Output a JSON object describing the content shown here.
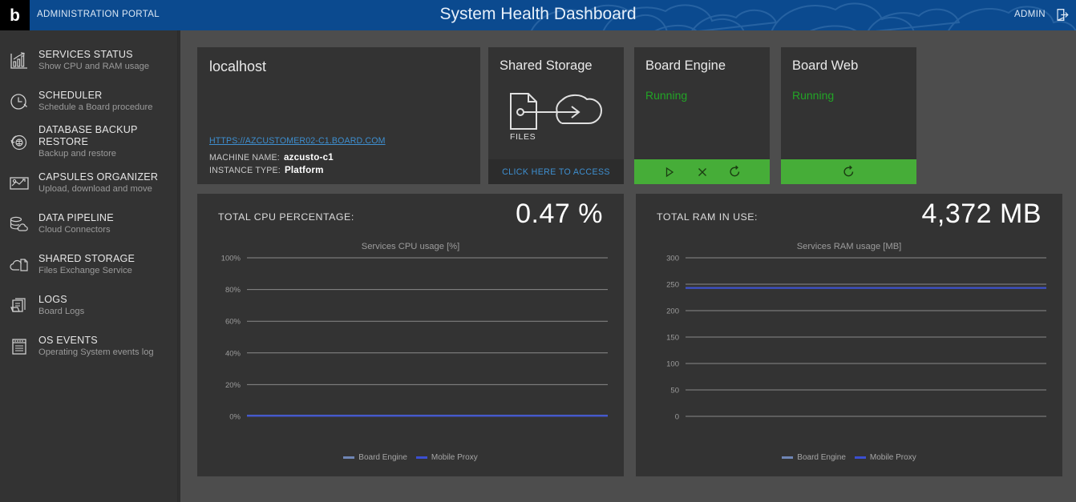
{
  "header": {
    "logo_glyph": "b",
    "portal_label": "ADMINISTRATION PORTAL",
    "title": "System Health Dashboard",
    "admin_label": "ADMIN",
    "logout_icon": "logout-icon",
    "bg_color": "#0b4a8f"
  },
  "sidebar": {
    "items": [
      {
        "icon": "chart-bars-icon",
        "title": "SERVICES STATUS",
        "subtitle": "Show CPU and RAM usage"
      },
      {
        "icon": "clock-icon",
        "title": "SCHEDULER",
        "subtitle": "Schedule a Board procedure"
      },
      {
        "icon": "database-sync-icon",
        "title": "DATABASE BACKUP RESTORE",
        "subtitle": "Backup and restore"
      },
      {
        "icon": "capsule-box-icon",
        "title": "CAPSULES ORGANIZER",
        "subtitle": "Upload, download and move"
      },
      {
        "icon": "data-pipeline-icon",
        "title": "DATA PIPELINE",
        "subtitle": "Cloud Connectors"
      },
      {
        "icon": "cloud-files-icon",
        "title": "SHARED STORAGE",
        "subtitle": "Files Exchange Service"
      },
      {
        "icon": "logs-icon",
        "title": "LOGS",
        "subtitle": "Board Logs"
      },
      {
        "icon": "events-list-icon",
        "title": "OS EVENTS",
        "subtitle": "Operating System events log"
      }
    ]
  },
  "main": {
    "host_card": {
      "title": "localhost",
      "link": "HTTPS://AZCUSTOMER02-C1.BOARD.COM",
      "machine_name_label": "MACHINE NAME:",
      "machine_name_value": "azcusto-c1",
      "instance_type_label": "INSTANCE TYPE:",
      "instance_type_value": "Platform"
    },
    "storage_card": {
      "title": "Shared Storage",
      "icon": "files-to-cloud-icon",
      "files_label": "FILES",
      "access_label": "CLICK HERE TO ACCESS",
      "link_color": "#3e8fd0"
    },
    "services": [
      {
        "name": "Board Engine",
        "status": "Running",
        "status_color": "#22a526",
        "footer_color": "#46ad38",
        "actions": [
          "play-icon",
          "stop-icon",
          "restart-icon"
        ]
      },
      {
        "name": "Board Web",
        "status": "Running",
        "status_color": "#22a526",
        "footer_color": "#46ad38",
        "actions": [
          "restart-icon"
        ]
      }
    ],
    "cpu_panel": {
      "metric_label": "TOTAL CPU PERCENTAGE:",
      "metric_value": "0.47 %"
    },
    "ram_panel": {
      "metric_label": "TOTAL RAM IN USE:",
      "metric_value": "4,372 MB"
    }
  },
  "chart_data": [
    {
      "type": "line",
      "id": "cpu",
      "title": "Services CPU usage [%]",
      "xlabel": "",
      "ylabel": "",
      "ylim": [
        0,
        100
      ],
      "yticks": [
        0,
        20,
        40,
        60,
        80,
        100
      ],
      "ytick_labels": [
        "0%",
        "20%",
        "40%",
        "60%",
        "80%",
        "100%"
      ],
      "grid": true,
      "legend_position": "bottom",
      "series": [
        {
          "name": "Board Engine",
          "color": "#6f86b5",
          "values": [
            0.5,
            0.5,
            0.5,
            0.5,
            0.5,
            0.5,
            0.5,
            0.5,
            0.5,
            0.5
          ]
        },
        {
          "name": "Mobile Proxy",
          "color": "#3b4fd1",
          "values": [
            0.3,
            0.3,
            0.3,
            0.3,
            0.3,
            0.3,
            0.3,
            0.3,
            0.3,
            0.3
          ]
        }
      ]
    },
    {
      "type": "line",
      "id": "ram",
      "title": "Services RAM usage [MB]",
      "xlabel": "",
      "ylabel": "",
      "ylim": [
        0,
        300
      ],
      "yticks": [
        0,
        50,
        100,
        150,
        200,
        250,
        300
      ],
      "ytick_labels": [
        "0",
        "50",
        "100",
        "150",
        "200",
        "250",
        "300"
      ],
      "grid": true,
      "legend_position": "bottom",
      "series": [
        {
          "name": "Board Engine",
          "color": "#6f86b5",
          "values": [
            243,
            243,
            243,
            243,
            243,
            243,
            243,
            243,
            243,
            243
          ]
        },
        {
          "name": "Mobile Proxy",
          "color": "#3b4fd1",
          "values": [
            243,
            243,
            243,
            243,
            243,
            243,
            243,
            243,
            243,
            243
          ]
        }
      ]
    }
  ]
}
